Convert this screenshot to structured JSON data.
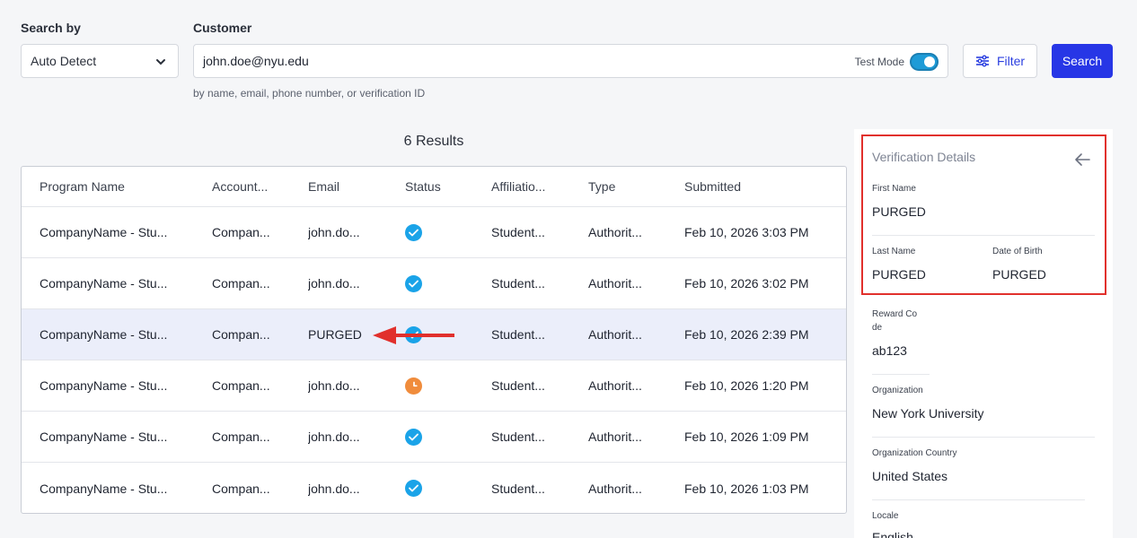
{
  "search": {
    "search_by_label": "Search by",
    "search_by_value": "Auto Detect",
    "customer_label": "Customer",
    "customer_value": "john.doe@nyu.edu",
    "test_mode_label": "Test Mode",
    "test_mode_on": true,
    "hint": "by name, email, phone number, or verification ID",
    "filter_label": "Filter",
    "search_label": "Search"
  },
  "results": {
    "count_text": "6 Results",
    "columns": [
      "Program Name",
      "Account...",
      "Email",
      "Status",
      "Affiliatio...",
      "Type",
      "Submitted"
    ],
    "rows": [
      {
        "program": "CompanyName - Stu...",
        "account": "Compan...",
        "email": "john.do...",
        "status": "verified",
        "affiliation": "Student...",
        "type": "Authorit...",
        "submitted": "Feb 10, 2026 3:03 PM"
      },
      {
        "program": "CompanyName - Stu...",
        "account": "Compan...",
        "email": "john.do...",
        "status": "verified",
        "affiliation": "Student...",
        "type": "Authorit...",
        "submitted": "Feb 10, 2026 3:02 PM"
      },
      {
        "program": "CompanyName - Stu...",
        "account": "Compan...",
        "email": "PURGED",
        "status": "verified",
        "affiliation": "Student...",
        "type": "Authorit...",
        "submitted": "Feb 10, 2026 2:39 PM"
      },
      {
        "program": "CompanyName - Stu...",
        "account": "Compan...",
        "email": "john.do...",
        "status": "pending",
        "affiliation": "Student...",
        "type": "Authorit...",
        "submitted": "Feb 10, 2026 1:20 PM"
      },
      {
        "program": "CompanyName - Stu...",
        "account": "Compan...",
        "email": "john.do...",
        "status": "verified",
        "affiliation": "Student...",
        "type": "Authorit...",
        "submitted": "Feb 10, 2026 1:09 PM"
      },
      {
        "program": "CompanyName - Stu...",
        "account": "Compan...",
        "email": "john.do...",
        "status": "verified",
        "affiliation": "Student...",
        "type": "Authorit...",
        "submitted": "Feb 10, 2026 1:03 PM"
      }
    ]
  },
  "details": {
    "title": "Verification Details",
    "first_name_label": "First Name",
    "first_name_value": "PURGED",
    "last_name_label": "Last Name",
    "last_name_value": "PURGED",
    "dob_label": "Date of Birth",
    "dob_value": "PURGED",
    "reward_label_1": "Reward Co",
    "reward_label_2": "de",
    "reward_value": "ab123",
    "org_label": "Organization",
    "org_value": "New York University",
    "org_country_label": "Organization Country",
    "org_country_value": "United States",
    "locale_label": "Locale",
    "locale_value": "English"
  },
  "colors": {
    "primary": "#2736e6",
    "verified": "#1aa3e8",
    "pending": "#f08c3c",
    "annotation": "#e1302c"
  }
}
